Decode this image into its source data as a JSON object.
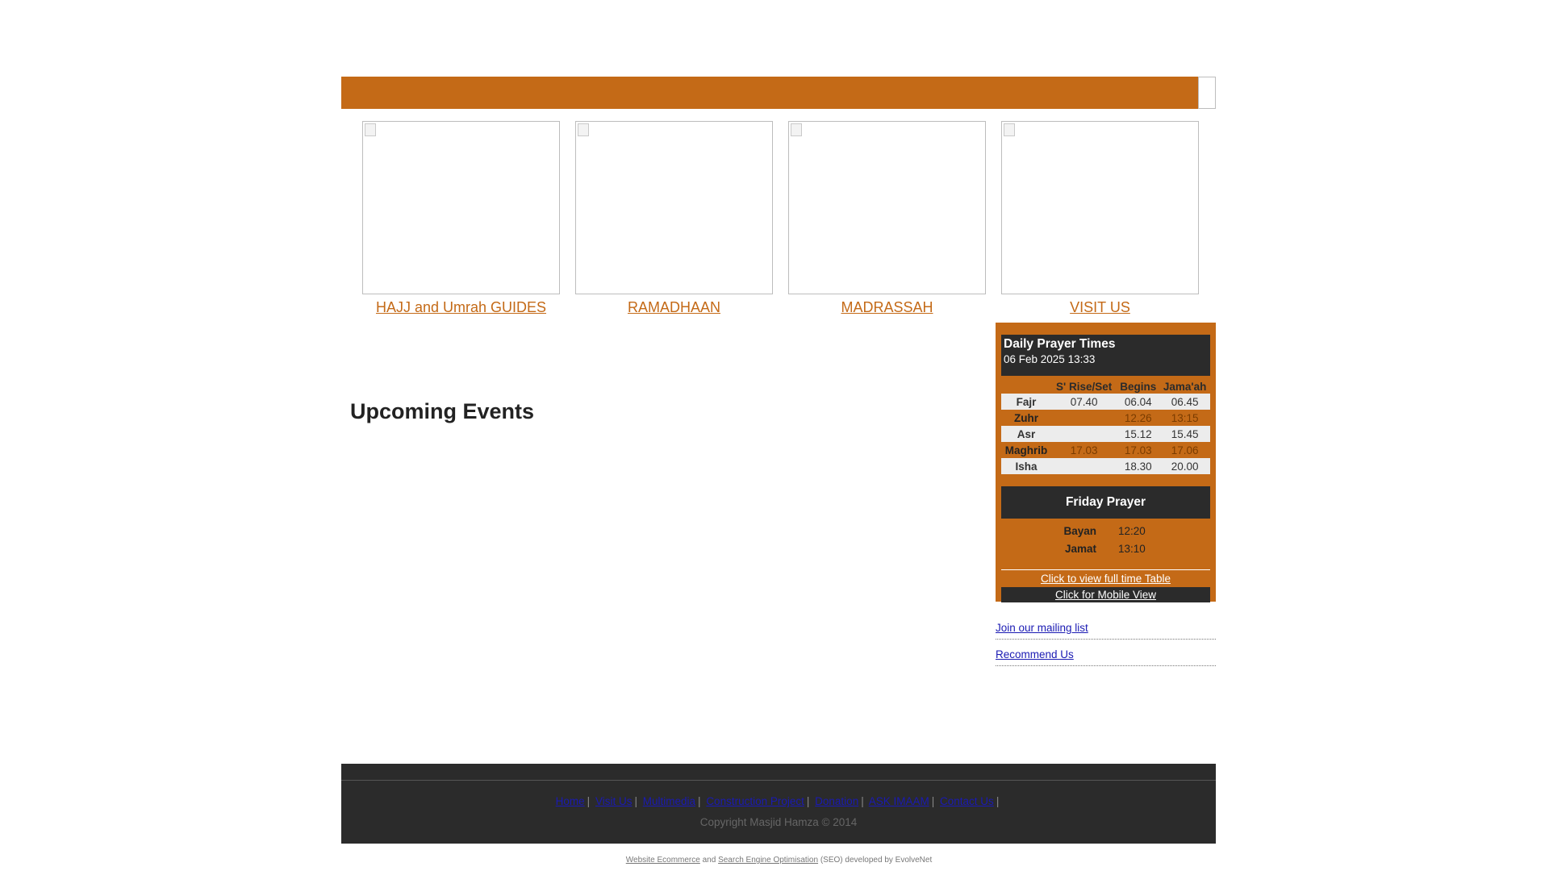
{
  "promos": [
    {
      "label": "HAJJ and Umrah GUIDES"
    },
    {
      "label": "RAMADHAAN"
    },
    {
      "label": "MADRASSAH"
    },
    {
      "label": "VISIT US"
    }
  ],
  "main": {
    "upcoming_title": "Upcoming Events"
  },
  "prayer": {
    "title": "Daily Prayer Times",
    "date": "06 Feb 2025  13:33",
    "headers": [
      "S' Rise/Set",
      "Begins",
      "Jama'ah"
    ],
    "rows": [
      {
        "name": "Fajr",
        "rise": "07.40",
        "begins": "06.04",
        "jamaah": "06.45"
      },
      {
        "name": "Zuhr",
        "rise": "",
        "begins": "12.26",
        "jamaah": "13:15"
      },
      {
        "name": "Asr",
        "rise": "",
        "begins": "15.12",
        "jamaah": "15.45"
      },
      {
        "name": "Maghrib",
        "rise": "17.03",
        "begins": "17.03",
        "jamaah": "17.06"
      },
      {
        "name": "Isha",
        "rise": "",
        "begins": "18.30",
        "jamaah": "20.00"
      }
    ],
    "friday_title": "Friday Prayer",
    "friday": [
      {
        "name": "Bayan",
        "time": "12:20"
      },
      {
        "name": "Jamat",
        "time": "13:10"
      }
    ],
    "timetable_link": "Click to view full time Table",
    "mobile_link": "Click for Mobile View"
  },
  "side_links": {
    "mailing": "Join our mailing list",
    "recommend": "Recommend Us"
  },
  "footer": {
    "nav": [
      "Home",
      "Visit Us",
      "Multimedia",
      "Construction Project",
      "Donation",
      "ASK IMAAM",
      "Contact Us"
    ],
    "copyright": "Copyright Masjid Hamza © 2014"
  },
  "credits": {
    "link1": "Website Ecommerce",
    "and": " and ",
    "link2": "Search Engine Optimisation",
    "rest": " (SEO) developed by EvolveNet"
  },
  "colors": {
    "accent": "#c46a17",
    "dark": "#2b2b2b",
    "link": "#1a1ab3"
  }
}
